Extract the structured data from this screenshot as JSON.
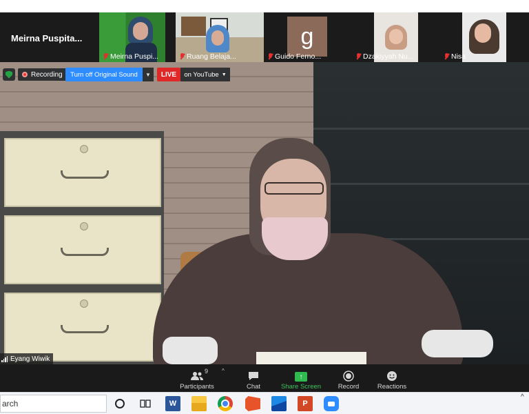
{
  "thumbnails": [
    {
      "name": "Meirna  Puspita...",
      "type": "name-only"
    },
    {
      "name": "Meirna Puspi...",
      "type": "video"
    },
    {
      "name": "Ruang Belaja...",
      "type": "video"
    },
    {
      "name": "Guido Ferno...",
      "type": "avatar",
      "avatar_letter": "g"
    },
    {
      "name": "Dzakiyyah Nu...",
      "type": "video"
    },
    {
      "name": "Nisa",
      "type": "video"
    }
  ],
  "meeting_bar": {
    "recording_label": "Recording",
    "original_sound_button": "Turn off Original Sound",
    "live_badge": "LIVE",
    "live_target": "on YouTube"
  },
  "active_speaker": "Eyang Wiwik",
  "toolbar": {
    "participants_label": "Participants",
    "participants_count": "9",
    "chat_label": "Chat",
    "share_label": "Share Screen",
    "record_label": "Record",
    "reactions_label": "Reactions"
  },
  "taskbar": {
    "search_text": "arch"
  },
  "colors": {
    "zoom_blue": "#2d8cff",
    "live_red": "#e02828",
    "share_green": "#2fb94f",
    "toolbar_bg": "#1a1a1a"
  }
}
